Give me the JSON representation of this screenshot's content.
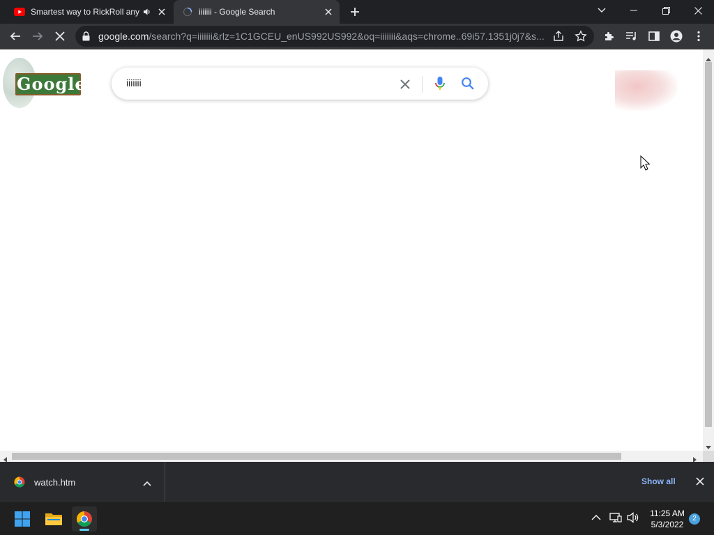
{
  "browser": {
    "tabs": [
      {
        "title": "Smartest way to RickRoll any",
        "favicon": "youtube-icon",
        "audio": "speaker-icon",
        "active": false
      },
      {
        "title": "iiiiiii - Google Search",
        "favicon": "loading-spinner-icon",
        "active": true
      }
    ],
    "address_bar": {
      "host": "google.com",
      "path": "/search?q=iiiiiii&rlz=1C1GCEU_enUS992US992&oq=iiiiiii&aqs=chrome..69i57.1351j0j7&s..."
    },
    "toolbar_icons": [
      "back-icon",
      "forward-icon",
      "stop-loading-icon",
      "lock-icon",
      "share-icon",
      "star-icon",
      "extensions-icon",
      "media-icon",
      "side-panel-icon",
      "profile-icon",
      "menu-icon"
    ]
  },
  "page": {
    "search_query": "iiiiiii",
    "logo_text": "Google",
    "icons": [
      "clear-icon",
      "microphone-icon",
      "search-icon"
    ]
  },
  "download_shelf": {
    "file_name": "watch.htm",
    "show_all_label": "Show all"
  },
  "taskbar": {
    "apps": [
      "windows-start-icon",
      "file-explorer-icon",
      "chrome-icon"
    ],
    "time": "11:25 AM",
    "date": "5/3/2022",
    "notification_count": "2"
  },
  "colors": {
    "tabstrip_bg": "#202124",
    "toolbar_bg": "#35363a",
    "accent_link": "#8ab4f8",
    "taskbar_bg": "#202020"
  }
}
